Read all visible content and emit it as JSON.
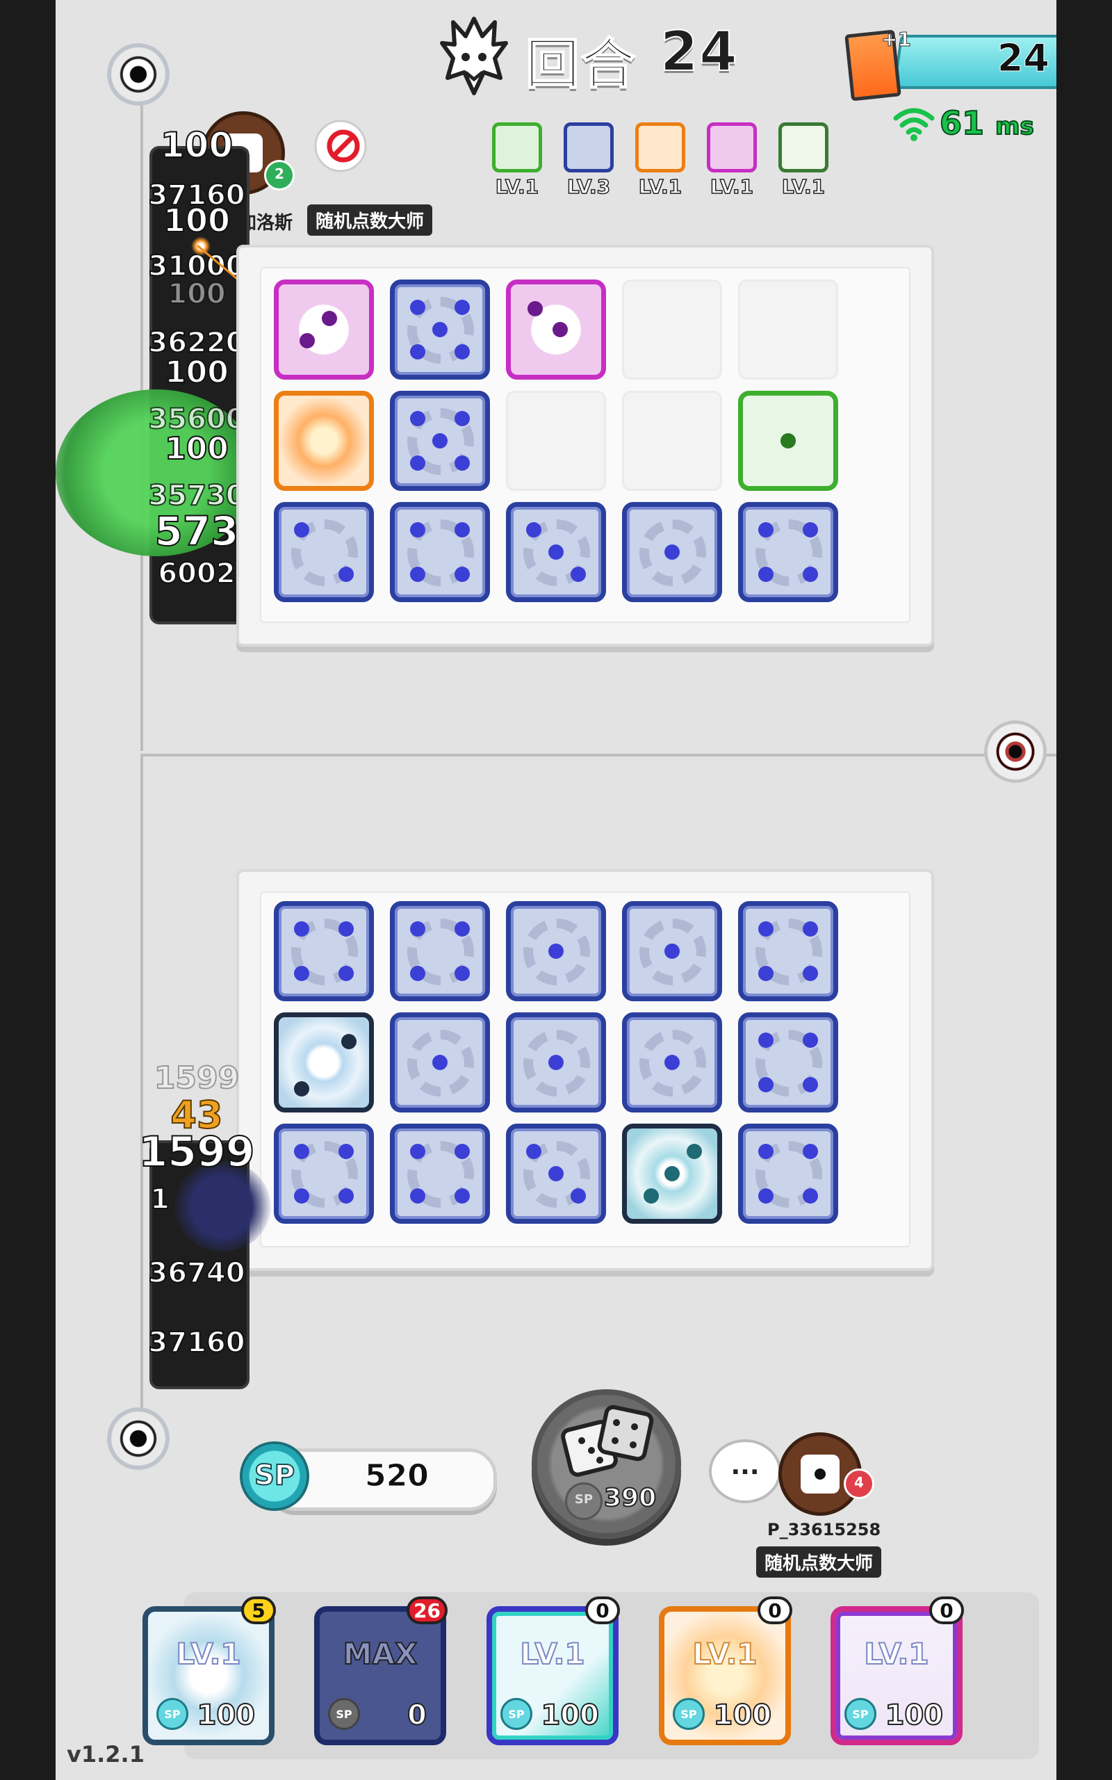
{
  "hud": {
    "round_label": "回合",
    "round_number": "24",
    "card_plus": "+1",
    "card_count": "24",
    "ping_value": "61",
    "ping_unit": "ms"
  },
  "opponent": {
    "name": "李兰丶加洛斯",
    "title": "随机点数大师",
    "rank_badge": "2",
    "deck_levels": [
      "LV.1",
      "LV.3",
      "LV.1",
      "LV.1",
      "LV.1"
    ]
  },
  "player": {
    "name": "P_33615258",
    "title": "随机点数大师",
    "rank_badge": "4",
    "chat_bubble": "...",
    "sp": "520",
    "roll_cost": "390",
    "sp_label": "SP"
  },
  "enemy_top_column": [
    "100",
    "37160",
    "100",
    "31000",
    "100",
    "36220",
    "100",
    "35600",
    "100",
    "35730",
    "573",
    "6002"
  ],
  "enemy_bottom_column": [
    "1599",
    "43",
    "1599",
    "1",
    "36740",
    "37160"
  ],
  "deck_cards": [
    {
      "level": "LV.1",
      "price": "100",
      "count": "5"
    },
    {
      "level": "MAX",
      "price": "0",
      "count": "26"
    },
    {
      "level": "LV.1",
      "price": "100",
      "count": "0"
    },
    {
      "level": "LV.1",
      "price": "100",
      "count": "0"
    },
    {
      "level": "LV.1",
      "price": "100",
      "count": "0"
    }
  ],
  "version": "v1.2.1",
  "colors": {
    "gear_border": "#2b3f9f",
    "pink_border": "#c72ec3",
    "orange_border": "#ec7f14",
    "green_border": "#3dae2e",
    "sp_cyan": "#47c9d6"
  },
  "icons": {
    "boss": "dragon-head-icon",
    "wifi": "wifi-icon",
    "emote": "no-emote-icon",
    "roll": "dice-icon"
  }
}
